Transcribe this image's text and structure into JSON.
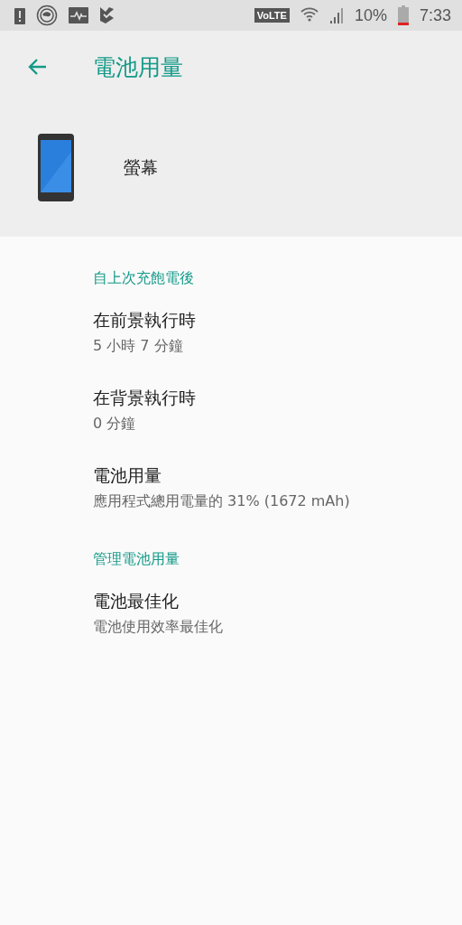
{
  "status_bar": {
    "volte": "VoLTE",
    "battery_percent": "10%",
    "time": "7:33"
  },
  "app_bar": {
    "title": "電池用量"
  },
  "header": {
    "app_name": "螢幕"
  },
  "sections": [
    {
      "title": "自上次充飽電後",
      "items": [
        {
          "title": "在前景執行時",
          "summary": "5 小時 7 分鐘"
        },
        {
          "title": "在背景執行時",
          "summary": "0 分鐘"
        },
        {
          "title": "電池用量",
          "summary": "應用程式總用電量的 31% (1672 mAh)"
        }
      ]
    },
    {
      "title": "管理電池用量",
      "items": [
        {
          "title": "電池最佳化",
          "summary": "電池使用效率最佳化"
        }
      ]
    }
  ]
}
